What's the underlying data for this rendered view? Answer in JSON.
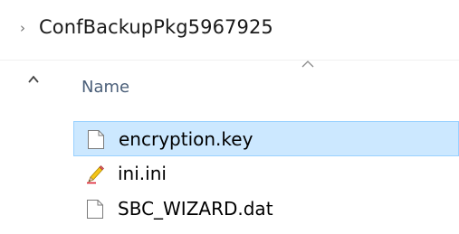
{
  "breadcrumb": {
    "folder": "ConfBackupPkg5967925"
  },
  "header": {
    "name_label": "Name"
  },
  "files": [
    {
      "name": "encryption.key",
      "icon": "blank-file-icon",
      "selected": true
    },
    {
      "name": "ini.ini",
      "icon": "ini-config-file-icon",
      "selected": false
    },
    {
      "name": "SBC_WIZARD.dat",
      "icon": "blank-file-icon",
      "selected": false
    }
  ],
  "colors": {
    "selection_bg": "#cce8ff",
    "selection_border": "#99d1ff",
    "header_text": "#4c607a"
  }
}
